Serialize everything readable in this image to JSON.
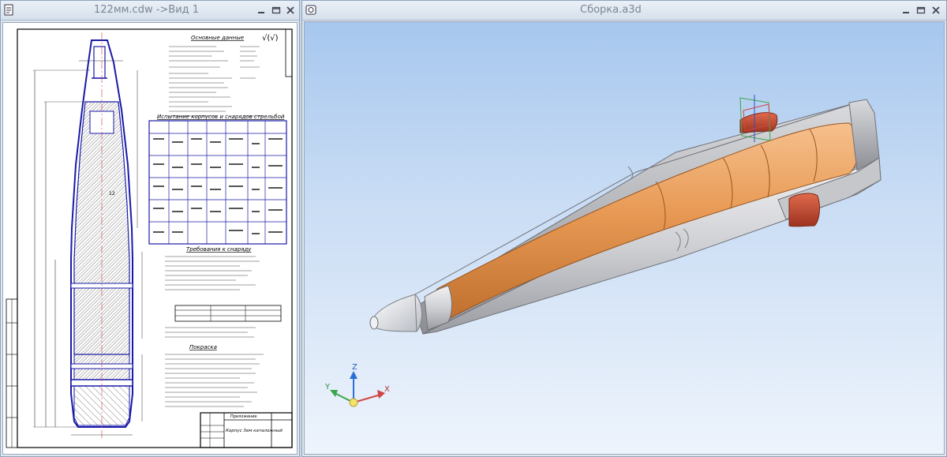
{
  "left_window": {
    "title": "122мм.cdw ->Вид 1",
    "drawing": {
      "check_mark": "√(√)",
      "headings": {
        "general": "Основные данные",
        "tests": "Испытание корпусов и снарядов стрельбой",
        "requirements": "Требования к снаряду",
        "painting": "Покраска"
      },
      "table": {
        "rows": 5,
        "columns": 7
      },
      "title_block": {
        "name": "Корпус 3ем каталожный",
        "stamp": "Приложение"
      },
      "dimension_label": "12"
    }
  },
  "right_window": {
    "title": "Сборка.a3d",
    "colors": {
      "shell_body": "#d4d5d8",
      "charge_core": "#e59a55",
      "band": "#c0462b",
      "background_top": "#a7c7ee",
      "background_bottom": "#eef4fc"
    },
    "triad": {
      "x": "X",
      "y": "Y",
      "z": "Z"
    }
  },
  "icons": {
    "left_sys": "document-icon",
    "right_sys": "assembly-icon",
    "minimize": "minimize-icon",
    "maximize": "maximize-icon",
    "close": "close-icon"
  }
}
